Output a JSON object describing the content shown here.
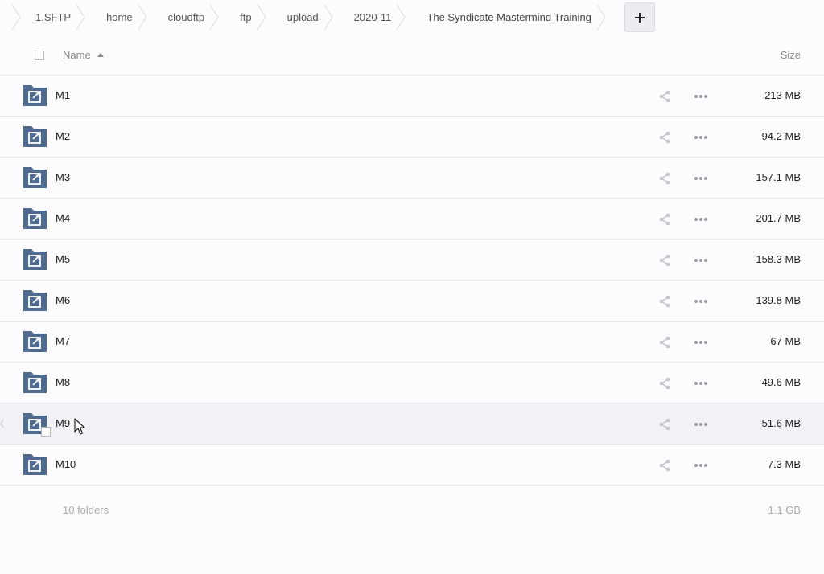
{
  "breadcrumb": {
    "items": [
      {
        "label": "1.SFTP"
      },
      {
        "label": "home"
      },
      {
        "label": "cloudftp"
      },
      {
        "label": "ftp"
      },
      {
        "label": "upload"
      },
      {
        "label": "2020-11"
      },
      {
        "label": "The Syndicate Mastermind Training"
      }
    ],
    "add_icon": "plus-icon"
  },
  "header": {
    "name_label": "Name",
    "size_label": "Size",
    "sort": "ascending"
  },
  "rows": [
    {
      "name": "M1",
      "size": "213 MB"
    },
    {
      "name": "M2",
      "size": "94.2 MB"
    },
    {
      "name": "M3",
      "size": "157.1 MB"
    },
    {
      "name": "M4",
      "size": "201.7 MB"
    },
    {
      "name": "M5",
      "size": "158.3 MB"
    },
    {
      "name": "M6",
      "size": "139.8 MB"
    },
    {
      "name": "M7",
      "size": "67 MB"
    },
    {
      "name": "M8",
      "size": "49.6 MB"
    },
    {
      "name": "M9",
      "size": "51.6 MB"
    },
    {
      "name": "M10",
      "size": "7.3 MB"
    }
  ],
  "footer": {
    "count": "10 folders",
    "total": "1.1 GB"
  },
  "colors": {
    "folder": "#4e6a8f",
    "background": "#fcfcff",
    "hover_row": "#f2f2f6",
    "muted_text": "#aaaaaa"
  }
}
